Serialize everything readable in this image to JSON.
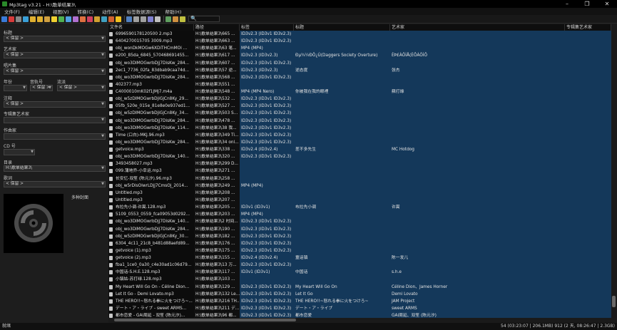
{
  "window": {
    "title": "Mp3tag v3.21  -  H:\\歌单结果3\\"
  },
  "menu": [
    "文件(F)",
    "编辑(E)",
    "视图(V)",
    "转换(C)",
    "动作(A)",
    "标签数据源(S)",
    "帮助(H)"
  ],
  "toolbar": {
    "search_icon": "🔍"
  },
  "panel": {
    "fields": [
      {
        "label": "标题",
        "value": "< 保留 >"
      },
      {
        "label": "艺术家",
        "value": "< 保留 >"
      },
      {
        "label": "唱片集",
        "value": "< 保留 >"
      },
      {
        "label": "年份",
        "value": ""
      },
      {
        "label": "音轨号",
        "value": "< 保留 >"
      },
      {
        "label": "流派",
        "value": "< 保留 >"
      },
      {
        "label": "注释",
        "value": "< 保留 >"
      },
      {
        "label": "专辑集艺术家",
        "value": ""
      },
      {
        "label": "作曲家",
        "value": ""
      },
      {
        "label": "CD 号",
        "value": ""
      },
      {
        "label": "目录",
        "value": "H:\\歌单结果3\\"
      },
      {
        "label": "歌词",
        "value": "< 保留 >"
      }
    ],
    "cover_label": "多种封面"
  },
  "columns": [
    "文件名",
    "路径",
    "标签",
    "标题",
    "艺术家",
    "专辑集艺术家"
  ],
  "rows": [
    [
      "6996590178120500 2.mp3",
      "H:\\歌单结果3\\665 ...",
      "ID3v2.3 (ID3v1 ID3v2.3)",
      "",
      ""
    ],
    [
      "6404270015705 3009.mp3",
      "H:\\歌单结果3\\663 ...",
      "ID3v2.3 (ID3v1 ID3v2.3)",
      "",
      ""
    ],
    [
      "obj_wonDkMOGw6XDiTHCmMOi ...",
      "H:\\歌单结果3\\63 笔...",
      "MP4 (MP4)",
      "",
      ""
    ],
    [
      "e200_85da_6845_570468691455...",
      "H:\\歌单结果3\\617 ...",
      "ID3v2.3 (ID3v2.3)",
      "Ðµ¾¼ÐÖ¿Ú(Daggers Society Overture)",
      "ÈÞ£ÀÖÌÅ(ÈÕÀÖÌÕ"
    ],
    [
      "obj_wo3DlMOGwrbDjj7DisKw_284...",
      "H:\\歌单结果3\\607 ...",
      "ID3v2.3 (ID3v1 ID3v2.3)",
      "",
      ""
    ],
    [
      "2ec1_7736_02fa_83dbab9caa74d...",
      "H:\\歌单结果3\\57 逆...",
      "ID3v2.3 (ID3v2.3)",
      "逆态度",
      "张杰"
    ],
    [
      "obj_wo3DlMOGwrbDjj7DisKw_284...",
      "H:\\歌单结果3\\568 ...",
      "ID3v2.3 (ID3v1 ID3v2.3)",
      "",
      ""
    ],
    [
      "402377.mp3",
      "H:\\歌单结果3\\551 ...",
      "",
      "",
      ""
    ],
    [
      "C4000010mK02f1JMJ7.m4a",
      "H:\\歌单结果3\\548 ...",
      "MP4 (MP4 Nero)",
      "你被我在我的眼裡",
      "蘇打綠"
    ],
    [
      "obj_w5zDlMOGwrbDjiGjCn8Ky_29...",
      "H:\\歌单结果3\\532 ...",
      "ID3v2.3 (ID3v1 ID3v2.3)",
      "",
      ""
    ],
    [
      "05fb_520e_015e_81e8e0e937ed1...",
      "H:\\歌单结果3\\527 ...",
      "ID3v2.3 (ID3v1 ID3v2.3)",
      "",
      ""
    ],
    [
      "obj_w5zDlMOGwrbDjiGjCn8Ky_34...",
      "H:\\歌单结果3\\503 S...",
      "ID3v2.3 (ID3v1 ID3v2.3)",
      "",
      ""
    ],
    [
      "obj_wo3DlMOGwrbDjj7DisKw_284...",
      "H:\\歌单结果3\\478 ...",
      "ID3v2.3 (ID3v1 ID3v2.3)",
      "",
      ""
    ],
    [
      "obj_wo3DlMOGwrbDjj7DisKw_114...",
      "H:\\歌单结果3\\38 我...",
      "ID3v2.3 (ID3v1 ID3v2.3)",
      "",
      ""
    ],
    [
      "Time (口白)-MKJ.96.mp3",
      "H:\\歌单结果3\\349 Ti...",
      "ID3v2.3 (ID3v1 ID3v2.3)",
      "",
      ""
    ],
    [
      "obj_wo3DlMOGwrbDjj7DisKw_284...",
      "H:\\歌单结果3\\34 onl...",
      "ID3v2.3 (ID3v1 ID3v2.3)",
      "",
      ""
    ],
    [
      "getvoice.mp3",
      "H:\\歌单结果3\\338 ...",
      "ID3v2.4 (ID3v2.4)",
      "差不多先生",
      "MC Hotdog"
    ],
    [
      "obj_wo3DlMOGwrbDjj7DisKw_140...",
      "H:\\歌单结果3\\320 ...",
      "ID3v2.3 (ID3v1 ID3v2.3)",
      "",
      ""
    ],
    [
      "3493458027.mp3",
      "H:\\歌单结果3\\299 D...",
      "",
      "",
      ""
    ],
    [
      "099.蒲地乔-小幸运.mp3",
      "H:\\歌单结果3\\271 ...",
      "",
      "",
      ""
    ],
    [
      "长安忆-双笙 (陈元汐).96.mp3",
      "H:\\歌单结果3\\258 ...",
      "",
      "",
      ""
    ],
    [
      "obj_w5rDlsOlwrLDjj7CmsOj_2014...",
      "H:\\歌单结果3\\249 ...",
      "MP4 (MP4)",
      "",
      ""
    ],
    [
      "Untitled.mp3",
      "H:\\歌单结果3\\208 ...",
      "",
      "",
      ""
    ],
    [
      "Untitled.mp3",
      "H:\\歌单结果3\\207 ...",
      "",
      "",
      ""
    ],
    [
      "布拉先小调-许嵩.128.mp3",
      "H:\\歌单结果3\\205 ...",
      "ID3v1 (ID3v1)",
      "布拉先小调",
      "许嵩"
    ],
    [
      "5109_0553_0559_fca09053d0292...",
      "H:\\歌单结果3\\203 ...",
      "MP4 (MP4)",
      "",
      ""
    ],
    [
      "obj_wo3DlMOGwrbDjj7DisKw_140...",
      "H:\\歌单结果3\\2 时间...",
      "ID3v2.3 (ID3v1 ID3v2.3)",
      "",
      ""
    ],
    [
      "obj_wo3DlMOGwrbDjj7DisKw_284...",
      "H:\\歌单结果3\\190 ...",
      "ID3v2.3 (ID3v1 ID3v2.3)",
      "",
      ""
    ],
    [
      "obj_w5zDlMOGwrbDjiGjCn8Ky_30...",
      "H:\\歌单结果3\\182 ...",
      "ID3v2.3 (ID3v1 ID3v2.3)",
      "",
      ""
    ],
    [
      "6304_4c11_21c8_b481d88aefd89...",
      "H:\\歌单结果3\\176 ...",
      "ID3v2.3 (ID3v1 ID3v2.3)",
      "",
      ""
    ],
    [
      "getvoice (1).mp3",
      "H:\\歌单结果3\\175 ...",
      "ID3v2.3 (ID3v1 ID3v2.3)",
      "",
      ""
    ],
    [
      "getvoice (2).mp3",
      "H:\\歌单结果3\\155 ...",
      "ID3v2.4 (ID3v2.4)",
      "童话镇",
      "陈一发儿"
    ],
    [
      "fba1_1ce0_0a30_c4e30ad1c06d79...",
      "H:\\歌单结果3\\13 万...",
      "ID3v2.3 (ID3v1 ID3v2.3)",
      "",
      ""
    ],
    [
      "中国话-S.H.E.128.mp3",
      "H:\\歌单结果3\\117 ...",
      "ID3v1 (ID3v1)",
      "中国话",
      "s.h.e"
    ],
    [
      "小镇姑-苏打绿.128.mp3",
      "H:\\歌单结果3\\103 ...",
      "",
      "",
      ""
    ],
    [
      "My Heart Will Go On - Céline Dion...",
      "H:\\歌单结果3\\129 ...",
      "ID3v2.3 (ID3v1 ID3v2.3)",
      "My Heart Will Go On",
      "Céline Dion、James Horner"
    ],
    [
      "Let It Go - Demi Lovato.mp3",
      "H:\\歌单结果3\\132 Le...",
      "ID3v2.3 (ID3v1 ID3v2.3)",
      "Let It Go",
      "Demi Lovato"
    ],
    [
      "THE HERO!!~怒れる拳に火をつけろ~...",
      "H:\\歌单结果3\\216 TH...",
      "ID3v2.3 (ID3v1 ID3v2.3)",
      "THE HERO!!~怒れる拳に火をつけろ~",
      "JAM Project"
    ],
    [
      "デート・ア・ライブ - sweet ARMS...",
      "H:\\歌单结果3\\211 デ...",
      "ID3v2.3 (ID3v1 ID3v2.3)",
      "デート・ア・ライブ",
      "sweet ARMS"
    ],
    [
      "都市恋爱 - GAI周延 - 双笙 (陈元汐)...",
      "H:\\歌单结果3\\96 都...",
      "ID3v2.3 (ID3v1 ID3v2.3)",
      "都市恋爱",
      "GAI周延、双笙 (陈元汐)"
    ]
  ],
  "status": {
    "left": "就绪",
    "right": "54 (03:23:07 | 206.1MB)    912 (2 天, 08:26:47 | 2.3GB)"
  }
}
